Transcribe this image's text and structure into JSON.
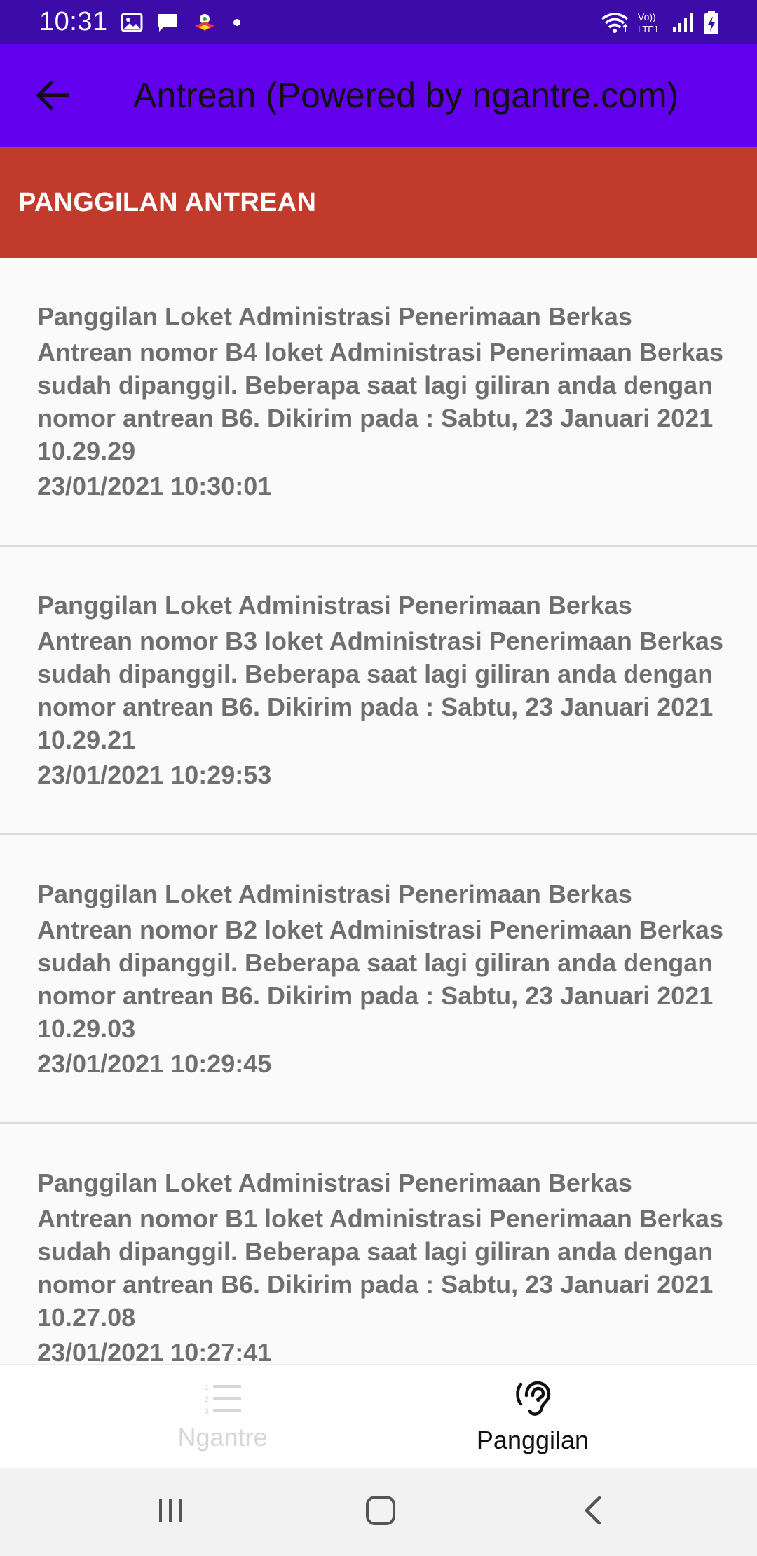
{
  "status_bar": {
    "time": "10:31",
    "left_icons": [
      "image-icon",
      "message-icon",
      "app-notification-icon",
      "dot-icon"
    ],
    "right_icons": [
      "wifi-icon",
      "volte-icon",
      "signal-icon",
      "battery-charging-icon"
    ],
    "volte_label_top": "Vo))",
    "volte_label_bottom": "LTE1"
  },
  "app_bar": {
    "title": "Antrean (Powered by ngantre.com)",
    "background": "#6200ee",
    "back_icon": "arrow-left-icon"
  },
  "section": {
    "title": "PANGGILAN ANTREAN",
    "background": "#c23a2c"
  },
  "items": [
    {
      "title": "Panggilan Loket Administrasi Penerimaan Berkas",
      "body": "Antrean nomor B4 loket Administrasi Penerimaan Berkas sudah dipanggil. Beberapa saat lagi giliran anda dengan nomor antrean B6. Dikirim pada : Sabtu, 23 Januari 2021 10.29.29",
      "date": "23/01/2021 10:30:01"
    },
    {
      "title": "Panggilan Loket Administrasi Penerimaan Berkas",
      "body": "Antrean nomor B3 loket Administrasi Penerimaan Berkas sudah dipanggil. Beberapa saat lagi giliran anda dengan nomor antrean B6. Dikirim pada : Sabtu, 23 Januari 2021 10.29.21",
      "date": "23/01/2021 10:29:53"
    },
    {
      "title": "Panggilan Loket Administrasi Penerimaan Berkas",
      "body": "Antrean nomor B2 loket Administrasi Penerimaan Berkas sudah dipanggil. Beberapa saat lagi giliran anda dengan nomor antrean B6. Dikirim pada : Sabtu, 23 Januari 2021 10.29.03",
      "date": "23/01/2021 10:29:45"
    },
    {
      "title": "Panggilan Loket Administrasi Penerimaan Berkas",
      "body": "Antrean nomor B1 loket Administrasi Penerimaan Berkas sudah dipanggil. Beberapa saat lagi giliran anda dengan nomor antrean B6. Dikirim pada : Sabtu, 23 Januari 2021 10.27.08",
      "date": "23/01/2021 10:27:41"
    }
  ],
  "bottom_nav": {
    "tabs": [
      {
        "label": "Ngantre",
        "icon": "numbered-list-icon",
        "active": false
      },
      {
        "label": "Panggilan",
        "icon": "hearing-icon",
        "active": true
      }
    ]
  },
  "system_nav": {
    "buttons": [
      "recent-apps-icon",
      "home-icon",
      "back-icon"
    ]
  }
}
